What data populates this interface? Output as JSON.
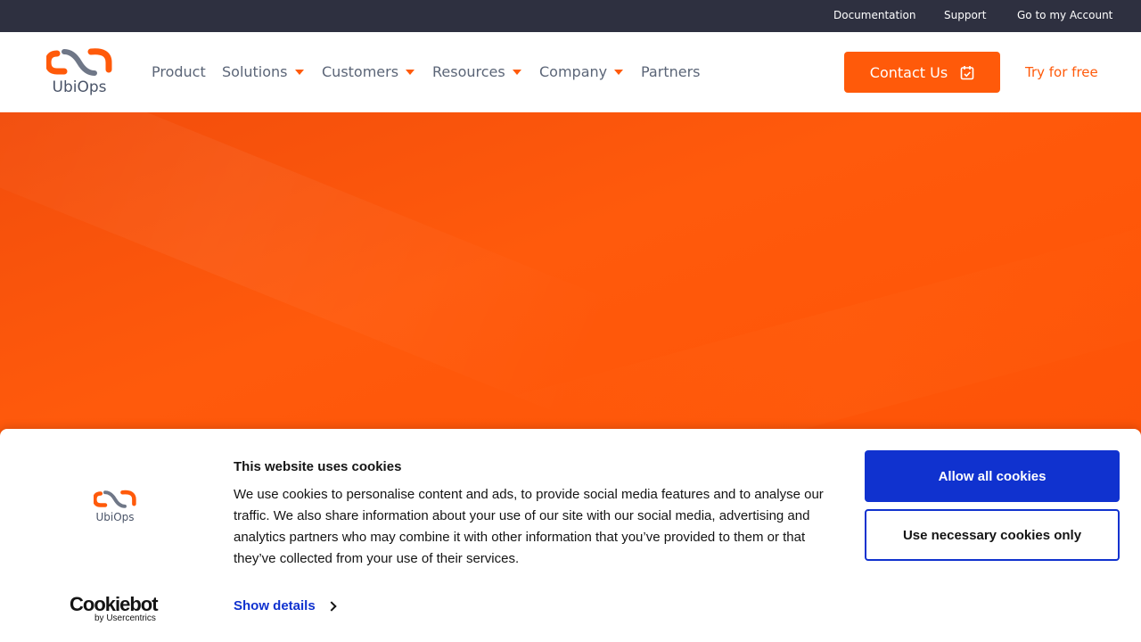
{
  "topbar": {
    "links": [
      "Documentation",
      "Support",
      "Go to my Account"
    ]
  },
  "header": {
    "logo_text": "UbiOps",
    "nav": [
      {
        "label": "Product",
        "dropdown": false
      },
      {
        "label": "Solutions",
        "dropdown": true
      },
      {
        "label": "Customers",
        "dropdown": true
      },
      {
        "label": "Resources",
        "dropdown": true
      },
      {
        "label": "Company",
        "dropdown": true
      },
      {
        "label": "Partners",
        "dropdown": false
      }
    ],
    "contact_label": "Contact Us",
    "try_label": "Try for free"
  },
  "cookie_banner": {
    "logo_text": "UbiOps",
    "title": "This website uses cookies",
    "text": "We use cookies to personalise content and ads, to provide social media features and to analyse our traffic. We also share information about your use of our site with our social media, advertising and analytics partners who may combine it with other information that you’ve provided to them or that they’ve collected from your use of their services.",
    "show_details": "Show details",
    "allow_all": "Allow all cookies",
    "necessary_only": "Use necessary cookies only",
    "brand_name": "Cookiebot",
    "brand_sub": "by Usercentrics"
  },
  "colors": {
    "accent": "#ff5a0a",
    "topbar": "#2e3040",
    "cookie_button": "#1032cf"
  }
}
